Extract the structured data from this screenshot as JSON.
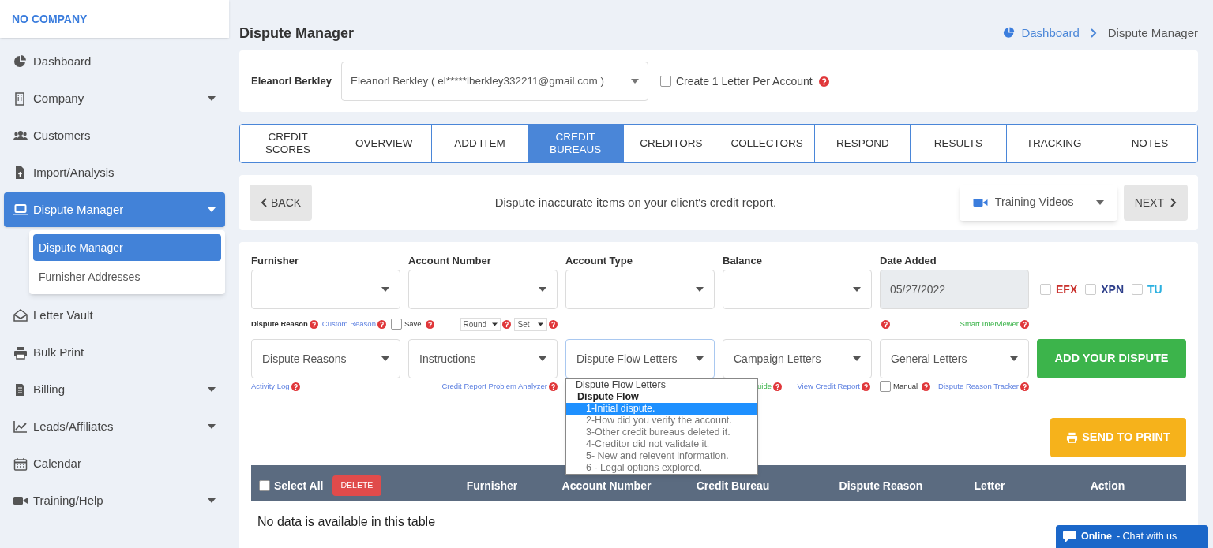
{
  "sidebar": {
    "company": "NO COMPANY",
    "items": [
      {
        "label": "Dashboard",
        "has_submenu": false,
        "selected": false
      },
      {
        "label": "Company",
        "has_submenu": true,
        "selected": false
      },
      {
        "label": "Customers",
        "has_submenu": false,
        "selected": false
      },
      {
        "label": "Import/Analysis",
        "has_submenu": false,
        "selected": false
      },
      {
        "label": "Dispute Manager",
        "has_submenu": true,
        "selected": true,
        "expanded": true,
        "children": [
          {
            "label": "Dispute Manager",
            "selected": true
          },
          {
            "label": "Furnisher Addresses",
            "selected": false
          }
        ]
      },
      {
        "label": "Letter Vault",
        "has_submenu": false,
        "selected": false
      },
      {
        "label": "Bulk Print",
        "has_submenu": false,
        "selected": false
      },
      {
        "label": "Billing",
        "has_submenu": true,
        "selected": false
      },
      {
        "label": "Leads/Affiliates",
        "has_submenu": true,
        "selected": false
      },
      {
        "label": "Calendar",
        "has_submenu": false,
        "selected": false
      },
      {
        "label": "Training/Help",
        "has_submenu": true,
        "selected": false
      }
    ]
  },
  "page_title": "Dispute Manager",
  "breadcrumb": [
    "Dashboard",
    "Dispute Manager"
  ],
  "client": {
    "name": "Eleanorl Berkley",
    "select_value": "Eleanorl Berkley ( el*****lberkley332211@gmail.com )",
    "one_letter_label": "Create 1 Letter Per Account",
    "one_letter_checked": false
  },
  "tabs": [
    {
      "label": "CREDIT SCORES",
      "selected": false
    },
    {
      "label": "OVERVIEW",
      "selected": false
    },
    {
      "label": "ADD ITEM",
      "selected": false
    },
    {
      "label": "CREDIT BUREAUS",
      "selected": true
    },
    {
      "label": "CREDITORS",
      "selected": false
    },
    {
      "label": "COLLECTORS",
      "selected": false
    },
    {
      "label": "RESPOND",
      "selected": false
    },
    {
      "label": "RESULTS",
      "selected": false
    },
    {
      "label": "TRACKING",
      "selected": false
    },
    {
      "label": "NOTES",
      "selected": false
    }
  ],
  "nav": {
    "back": "BACK",
    "message": "Dispute inaccurate items on your client's credit report.",
    "training": "Training Videos",
    "next": "NEXT"
  },
  "form": {
    "fields": [
      {
        "label": "Furnisher"
      },
      {
        "label": "Account Number"
      },
      {
        "label": "Account Type"
      },
      {
        "label": "Balance"
      },
      {
        "label": "Date Added",
        "value": "05/27/2022",
        "disabled": true
      }
    ],
    "bureaus": [
      {
        "label": "EFX",
        "checked": false,
        "color": "#c9302c"
      },
      {
        "label": "XPN",
        "checked": false,
        "color": "#2d3e8a"
      },
      {
        "label": "TU",
        "checked": false,
        "color": "#2bb0e0"
      }
    ],
    "dispute_reason_label": "Dispute Reason",
    "custom_reason": "Custom Reason",
    "save_label": "Save",
    "save_checked": false,
    "round": "Round",
    "set": "Set",
    "smart_interviewer": "Smart Interviewer",
    "selects": [
      "Dispute Reasons",
      "Instructions",
      "Dispute Flow Letters",
      "Campaign Letters",
      "General Letters"
    ],
    "add_button": "ADD YOUR DISPUTE",
    "activity_log": "Activity Log",
    "analyzer": "Credit Report Problem Analyzer",
    "guide_fragment": "uide",
    "view_report": "View Credit Report",
    "manual_label": "Manual",
    "manual_checked": false,
    "tracker": "Dispute Reason Tracker",
    "dropdown": {
      "header": "Dispute Flow Letters",
      "group": "Dispute Flow",
      "options": [
        {
          "label": "1-Initial dispute.",
          "selected": true
        },
        {
          "label": "2-How did you verify the account.",
          "selected": false
        },
        {
          "label": "3-Other credit bureaus deleted it.",
          "selected": false
        },
        {
          "label": "4-Creditor did not validate it.",
          "selected": false
        },
        {
          "label": "5- New and relevent information.",
          "selected": false
        },
        {
          "label": "6 - Legal options explored.",
          "selected": false
        }
      ]
    },
    "print_button": "SEND TO PRINT"
  },
  "table": {
    "select_all": "Select All",
    "select_all_checked": false,
    "delete": "DELETE",
    "columns": [
      "Furnisher",
      "Account Number",
      "Credit Bureau",
      "Dispute Reason",
      "Letter",
      "Action"
    ],
    "empty": "No data is available in this table"
  },
  "chat": {
    "status": "Online",
    "text": "- Chat with us"
  }
}
